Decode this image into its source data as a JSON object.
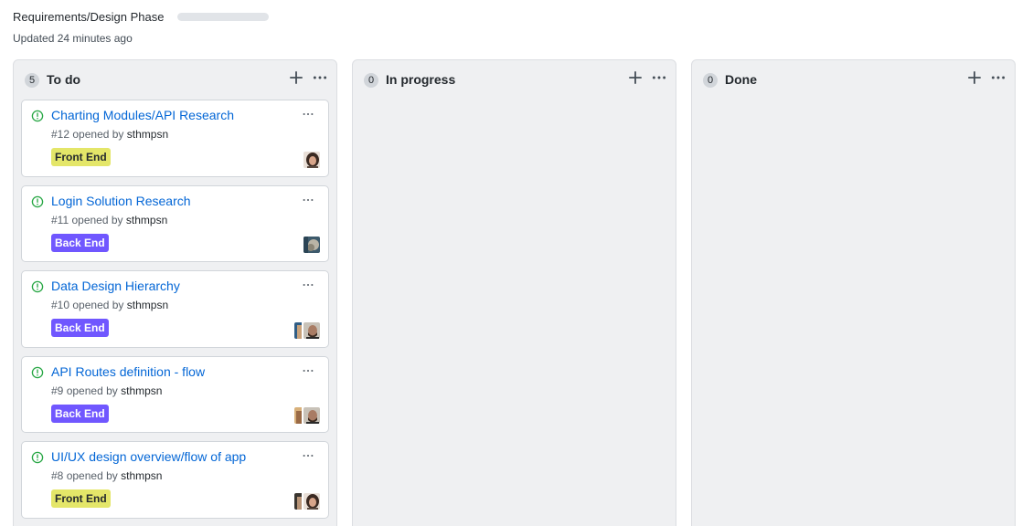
{
  "project": {
    "title": "Requirements/Design Phase",
    "updated": "Updated 24 minutes ago",
    "progress_fraction": 0
  },
  "columns": [
    {
      "name": "To do",
      "count": "5",
      "cards": [
        {
          "title": "Charting Modules/API Research",
          "number": "#12",
          "opened_by": "opened by",
          "author": "sthmpsn",
          "label": "Front End",
          "label_color": "#e4e669",
          "label_text_color": "#24292e",
          "assignees": [
            "avatar-woman-dark-hair"
          ]
        },
        {
          "title": "Login Solution Research",
          "number": "#11",
          "opened_by": "opened by",
          "author": "sthmpsn",
          "label": "Back End",
          "label_color": "#7057ff",
          "label_text_color": "#ffffff",
          "assignees": [
            "avatar-blue-gray"
          ]
        },
        {
          "title": "Data Design Hierarchy",
          "number": "#10",
          "opened_by": "opened by",
          "author": "sthmpsn",
          "label": "Back End",
          "label_color": "#7057ff",
          "label_text_color": "#ffffff",
          "assignees": [
            "avatar-blue-partial",
            "avatar-man-bearded"
          ]
        },
        {
          "title": "API Routes definition - flow",
          "number": "#9",
          "opened_by": "opened by",
          "author": "sthmpsn",
          "label": "Back End",
          "label_color": "#7057ff",
          "label_text_color": "#ffffff",
          "assignees": [
            "avatar-tan-partial",
            "avatar-man-bearded"
          ]
        },
        {
          "title": "UI/UX design overview/flow of app",
          "number": "#8",
          "opened_by": "opened by",
          "author": "sthmpsn",
          "label": "Front End",
          "label_color": "#e4e669",
          "label_text_color": "#24292e",
          "assignees": [
            "avatar-dark-partial",
            "avatar-woman-dark-hair"
          ]
        }
      ]
    },
    {
      "name": "In progress",
      "count": "0",
      "cards": []
    },
    {
      "name": "Done",
      "count": "0",
      "cards": []
    }
  ],
  "colors": {
    "accent_link": "#0366d6",
    "open_issue_green": "#28a745",
    "column_bg": "#eff0f2"
  },
  "icons": {
    "add": "plus-icon",
    "more": "kebab-horizontal-icon",
    "issue": "issue-opened-icon"
  }
}
